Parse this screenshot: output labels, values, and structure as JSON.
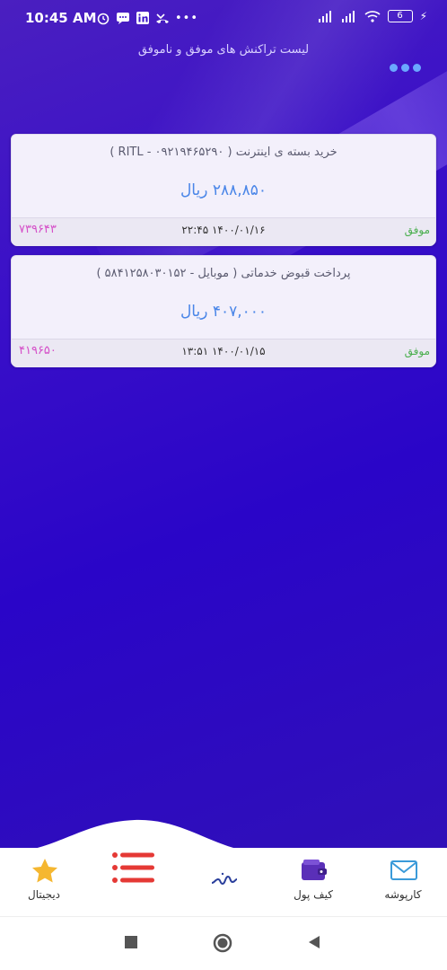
{
  "status_bar": {
    "time": "10:45 AM",
    "battery": "6"
  },
  "page_title": "لیست تراکنش های موفق و ناموفق",
  "transactions": [
    {
      "description": "خرید بسته ی اینترنت ( RITL - ۰۹۲۱۹۴۶۵۲۹۰ )",
      "amount": "۲۸۸,۸۵۰ ریال",
      "status": "موفق",
      "datetime": "۲۲:۴۵ ۱۴۰۰/۰۱/۱۶",
      "reference": "۷۳۹۶۴۳"
    },
    {
      "description": "پرداخت قبوض خدماتی ( موبایل - ۵۸۴۱۲۵۸۰۳۰۱۵۲ )",
      "amount": "۴۰۷,۰۰۰ ریال",
      "status": "موفق",
      "datetime": "۱۳:۵۱ ۱۴۰۰/۰۱/۱۵",
      "reference": "۴۱۹۶۵۰"
    }
  ],
  "bottom_nav": {
    "digital": "دیجیتال",
    "wallet": "کیف پول",
    "folder": "کارپوشه"
  },
  "colors": {
    "accent": "#4a86e8",
    "success": "#4caf50",
    "ref": "#d54fc8",
    "menu": "#e53935"
  }
}
